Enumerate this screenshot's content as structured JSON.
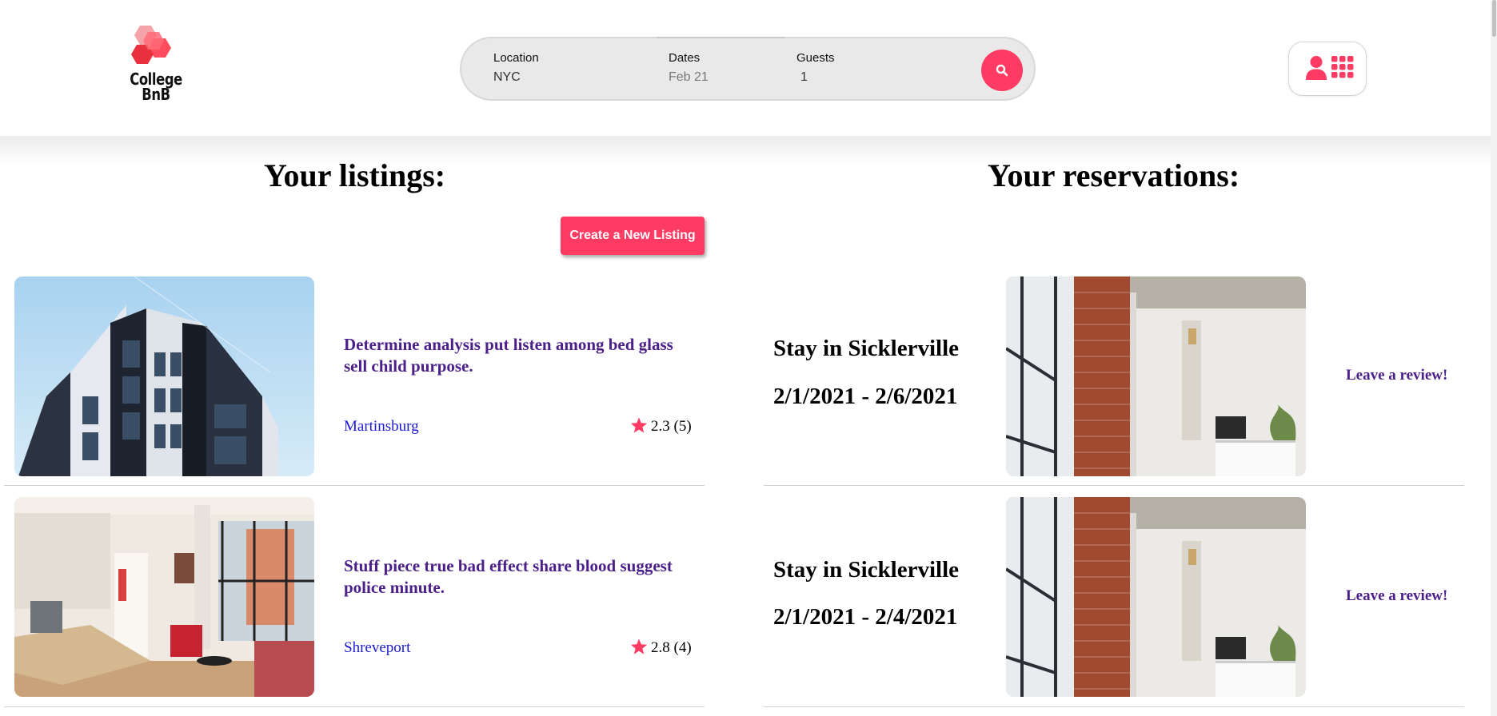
{
  "header": {
    "logo_text_line1": "College",
    "logo_text_line2": "BnB",
    "search": {
      "location_label": "Location",
      "location_value": "NYC",
      "dates_label": "Dates",
      "dates_value": "Feb 21",
      "guests_label": "Guests",
      "guests_value": "1"
    },
    "icons": {
      "search": "search-icon",
      "user": "user-icon",
      "menu": "grid-menu-icon"
    }
  },
  "listings": {
    "title": "Your listings:",
    "create_button": "Create a New Listing",
    "items": [
      {
        "title": "Determine analysis put listen among bed glass sell child purpose.",
        "city": "Martinsburg",
        "rating": "2.3 (5)",
        "image": "modern-apartment-building-photo"
      },
      {
        "title": "Stuff piece true bad effect share blood suggest police minute.",
        "city": "Shreveport",
        "rating": "2.8 (4)",
        "image": "living-room-interior-photo"
      }
    ]
  },
  "reservations": {
    "title": "Your reservations:",
    "items": [
      {
        "place": "Stay in Sicklerville",
        "dates": "2/1/2021 - 2/6/2021",
        "review": "Leave a review!",
        "image": "brick-wall-loft-photo"
      },
      {
        "place": "Stay in Sicklerville",
        "dates": "2/1/2021 - 2/4/2021",
        "review": "Leave a review!",
        "image": "brick-wall-loft-photo"
      }
    ]
  },
  "colors": {
    "accent": "#ff3b63",
    "link_purple": "#4b1f8a",
    "link_blue": "#1a1ad6"
  }
}
